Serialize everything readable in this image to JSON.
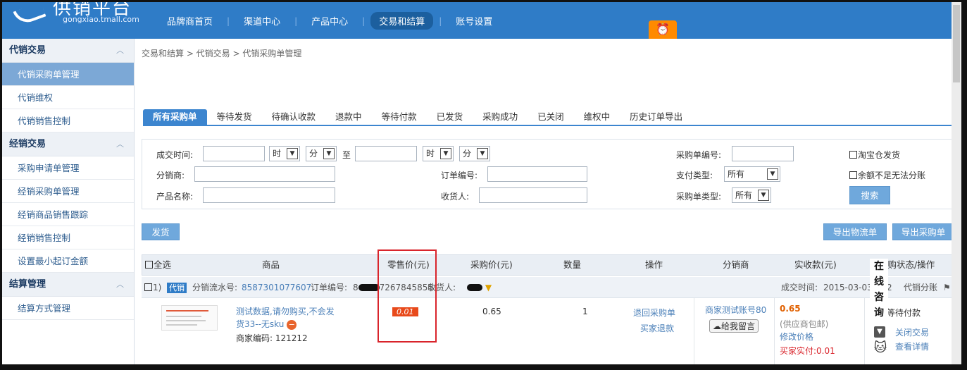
{
  "header": {
    "logo_title": "供销平台",
    "logo_domain": "gongxiao.tmall.com",
    "nav": [
      "品牌商首页",
      "渠道中心",
      "产品中心",
      "交易和结算",
      "账号设置"
    ],
    "active_nav": "交易和结算",
    "alarm_icon": "⏰"
  },
  "sidebar": {
    "sections": [
      {
        "title": "代销交易",
        "items": [
          "代销采购单管理",
          "代销维权",
          "代销销售控制"
        ]
      },
      {
        "title": "经销交易",
        "items": [
          "采购申请单管理",
          "经销采购单管理",
          "经销商品销售跟踪",
          "经销销售控制",
          "设置最小起订金额"
        ]
      },
      {
        "title": "结算管理",
        "items": [
          "结算方式管理"
        ]
      }
    ],
    "chevron": "︿"
  },
  "breadcrumb": "交易和结算 > 代销交易 > 代销采购单管理",
  "tabs": [
    "所有采购单",
    "等待发货",
    "待确认收款",
    "退款中",
    "等待付款",
    "已发货",
    "采购成功",
    "已关闭",
    "维权中",
    "历史订单导出"
  ],
  "filter": {
    "deal_time_label": "成交时间:",
    "hour_label": "时",
    "minute_label": "分",
    "to_label": "至",
    "distributor_label": "分销商:",
    "product_name_label": "产品名称:",
    "order_no_label": "订单编号:",
    "receiver_label": "收货人:",
    "purchase_no_label": "采购单编号:",
    "pay_type_label": "支付类型:",
    "pay_type_value": "所有",
    "purchase_type_label": "采购单类型:",
    "purchase_type_value": "所有",
    "taobao_ship_label": "淘宝仓发货",
    "balance_label": "余额不足无法分账",
    "search_label": "搜索"
  },
  "actions": {
    "ship": "发货",
    "export_logistics": "导出物流单",
    "export_purchase": "导出采购单"
  },
  "grid": {
    "headers": [
      "全选",
      "商品",
      "零售价(元)",
      "采购价(元)",
      "数量",
      "操作",
      "分销商",
      "实收款(元)",
      "采购状态/操作"
    ],
    "order": {
      "flow_no_label": "分销流水号:",
      "flow_no": "8587301077607",
      "order_no_label": "订单编号:",
      "order_no_visible": "8",
      "order_no_tail": "7267845855",
      "receiver_label": "收货人:",
      "tag": "代销",
      "seq": "1)",
      "deal_time_label": "成交时间:",
      "deal_time": "2015-03-03",
      "deal_time_tail": "2",
      "split_label": "代销分账"
    },
    "row": {
      "product_title": "测试数据,请勿购买,不会发货33--无sku",
      "merchant_code_label": "商家编码:",
      "merchant_code": "121212",
      "retail_price": "0.01",
      "purchase_price": "0.65",
      "quantity": "1",
      "op_return": "退回采购单",
      "op_refund": "买家退款",
      "distributor": "商家测试账号80",
      "leave_msg": "给我留言",
      "received": "0.65",
      "supplier_ship": "(供应商包邮)",
      "modify_price": "修改价格",
      "buyer_paid": "买家实付:0.01",
      "status": "等待付款",
      "close_deal": "关闭交易",
      "view_detail": "查看详情"
    }
  },
  "chat_widget": "在线咨询"
}
